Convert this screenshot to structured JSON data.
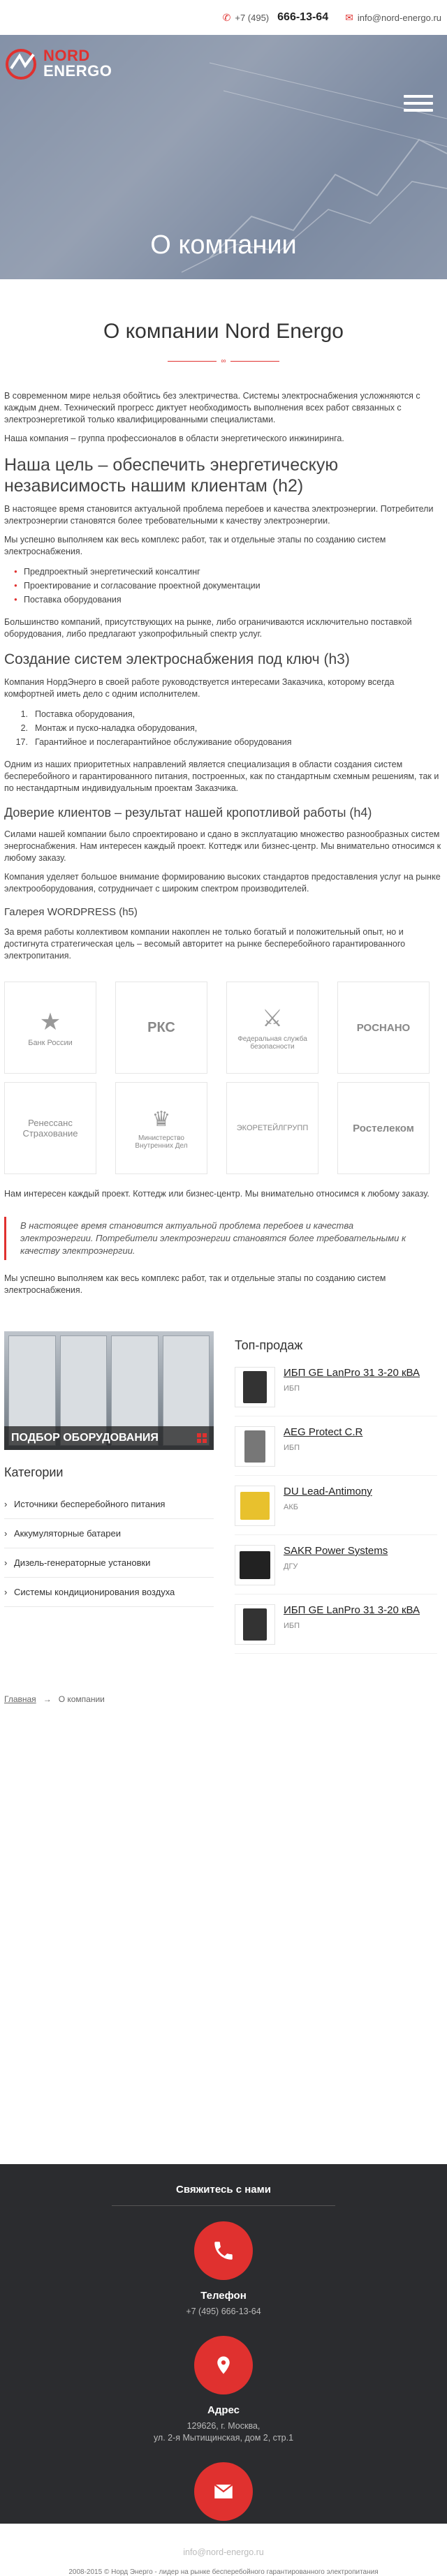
{
  "topbar": {
    "phone_prefix": "+7 (495)",
    "phone_number": "666-13-64",
    "email": "info@nord-energo.ru"
  },
  "brand": {
    "line1": "NORD",
    "line2": "ENERGO"
  },
  "hero": {
    "title": "О компании"
  },
  "page": {
    "title": "О компании Nord Energo"
  },
  "content": {
    "p1": "В современном мире нельзя обойтись без электричества. Системы электроснабжения усложняются с каждым днем. Технический прогресс диктует необходимость выполнения всех работ связанных с электроэнергетикой только квалифицированными специалистами.",
    "p2": "Наша компания – группа профессионалов в области энергетического инжиниринга.",
    "h2": "Наша цель – обеспечить энергетическую независимость нашим клиентам (h2)",
    "p3": "В настоящее время становится актуальной проблема перебоев и качества электроэнергии. Потребители электроэнергии становятся более требовательными к качеству электроэнергии.",
    "p4": "Мы успешно выполняем как весь комплекс работ, так и отдельные этапы по созданию систем электроснабжения.",
    "ul": [
      "Предпроектный энергетический консалтинг",
      "Проектирование и согласование проектной документации",
      "Поставка оборудования"
    ],
    "p5": "Большинство компаний, присутствующих на рынке, либо ограничиваются исключительно поставкой оборудования, либо предлагают узкопрофильный спектр услуг.",
    "h3": "Создание систем электроснабжения под ключ (h3)",
    "p6": "Компания НордЭнерго в своей работе руководствуется интересами Заказчика, которому всегда комфортней иметь дело с одним исполнителем.",
    "ol": [
      "Поставка оборудования,",
      "Монтаж и пуско-наладка оборудования,",
      "Гарантийное и послегарантийное обслуживание оборудования"
    ],
    "ol_nums": [
      "1.",
      "2.",
      "17."
    ],
    "p7": "Одним из наших приоритетных направлений является специализация в области создания систем бесперебойного и гарантированного питания, построенных, как по стандартным схемным решениям, так и по нестандартным индивидуальным проектам Заказчика.",
    "h4": "Доверие клиентов – результат нашей кропотливой работы (h4)",
    "p8": "Силами нашей компании было спроектировано и сдано в эксплуатацию множество разнообразных систем энергоснабжения. Нам интересен каждый проект. Коттедж или бизнес-центр. Мы внимательно относимся к любому заказу.",
    "p9": "Компания уделяет большое внимание формированию высоких стандартов предоставления услуг на рынке электрооборудования, сотрудничает с широким спектром производителей.",
    "h5": "Галерея WORDPRESS (h5)",
    "p10": "За время работы коллективом компании накоплен не только богатый и положительный опыт, но и достигнута стратегическая цель – весомый авторитет на рынке бесперебойного гарантированного электропитания.",
    "p11": "Нам интересен каждый проект. Коттедж или бизнес-центр. Мы внимательно относимся к любому заказу.",
    "quote": "В настоящее время становится актуальной проблема перебоев и качества электроэнергии. Потребители электроэнергии становятся более требовательными к качеству электроэнергии.",
    "p12": "Мы успешно выполняем как весь комплекс работ, так и отдельные этапы по созданию систем электроснабжения."
  },
  "partners": [
    {
      "name": "Банк России",
      "icon": "bank-russia-emblem"
    },
    {
      "name": "РКС",
      "icon": "rks-logo"
    },
    {
      "name": "Федеральная служба безопасности",
      "icon": "fsb-emblem"
    },
    {
      "name": "РОСНАНО",
      "icon": "rosnano-logo"
    },
    {
      "name": "Ренессанс Страхование",
      "icon": "renaissance-logo"
    },
    {
      "name": "Министерство Внутренних Дел",
      "icon": "mvd-emblem"
    },
    {
      "name": "ЭКОРЕТЕЙЛГРУПП",
      "icon": "ecoretail-logo"
    },
    {
      "name": "Ростелеком",
      "icon": "rostelecom-logo"
    }
  ],
  "promo": {
    "label": "ПОДБОР ОБОРУДОВАНИЯ"
  },
  "categories": {
    "title": "Категории",
    "items": [
      "Источники бесперебойного питания",
      "Аккумуляторные батареи",
      "Дизель-генераторные установки",
      "Системы кондиционирования воздуха"
    ]
  },
  "top_sales": {
    "title": "Топ-продаж",
    "items": [
      {
        "name": "ИБП GE LanPro 31 3-20 кВА",
        "cat": "ИБП",
        "thumb": "ups-black"
      },
      {
        "name": "AEG Protect C.R",
        "cat": "ИБП",
        "thumb": "ups-tower"
      },
      {
        "name": "DU Lead-Antimony",
        "cat": "АКБ",
        "thumb": "battery-yellow"
      },
      {
        "name": "SAKR Power Systems",
        "cat": "ДГУ",
        "thumb": "generator"
      },
      {
        "name": "ИБП GE LanPro 31 3-20 кВА",
        "cat": "ИБП",
        "thumb": "ups-black"
      }
    ]
  },
  "breadcrumb": {
    "home": "Главная",
    "sep": "→",
    "current": "О компании"
  },
  "footer": {
    "title": "Свяжитесь с нами",
    "phone_label": "Телефон",
    "phone_value": "+7 (495) 666-13-64",
    "address_label": "Адрес",
    "address_line1": "129626, г. Москва,",
    "address_line2": "ул. 2-я Мытищинская, дом 2, стр.1",
    "email_label": "Email",
    "email_value": "info@nord-energo.ru",
    "copyright": "2008-2015 © Норд Энерго - лидер на рынке бесперебойного гарантированного электропитания"
  },
  "colors": {
    "accent": "#e0312f",
    "footer_bg": "#2b2c2f"
  }
}
